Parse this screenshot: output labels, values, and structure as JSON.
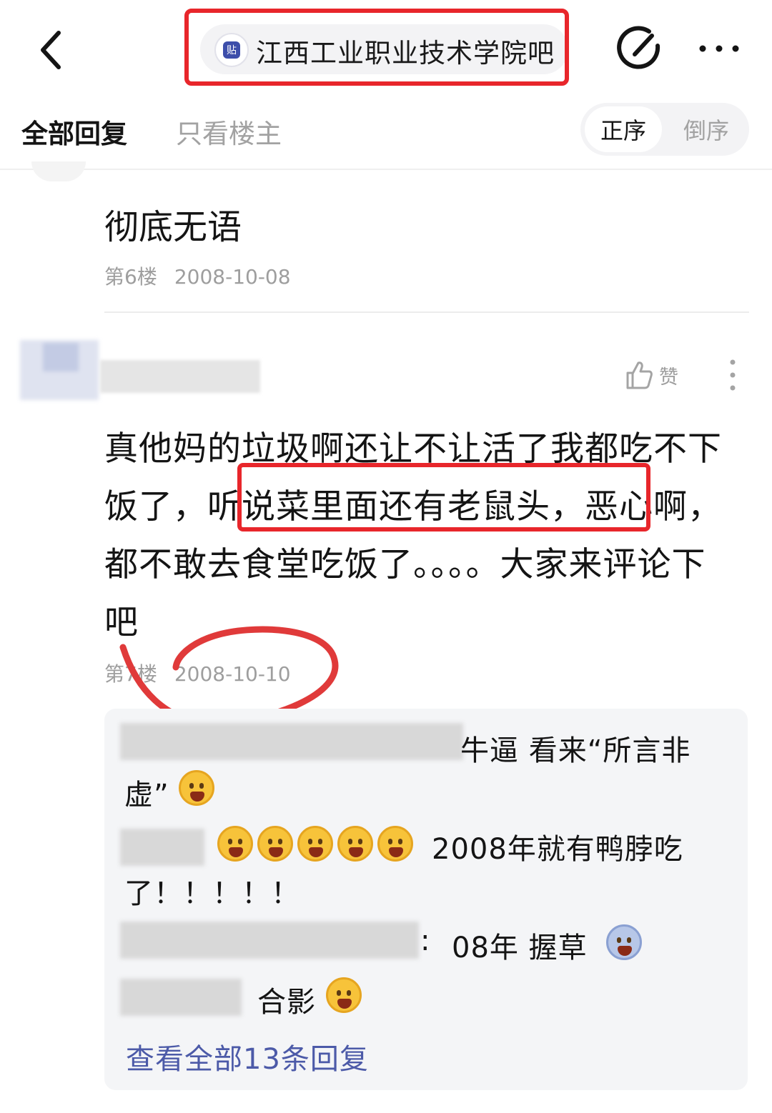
{
  "header": {
    "forum_name": "江西工业职业技术学院吧",
    "logo_glyph": "贴",
    "highlight_color": "#e8262b"
  },
  "tabs": {
    "all_replies": "全部回复",
    "op_only": "只看楼主",
    "sort_asc": "正序",
    "sort_desc": "倒序"
  },
  "floor6": {
    "text": "彻底无语",
    "floor_label": "第6楼",
    "date": "2008-10-08"
  },
  "floor7": {
    "like_label": "赞",
    "body_before": "真他妈的垃圾啊还让不让活了我都吃不下饭了，",
    "body_highlight": "听说菜里面还有老鼠头，",
    "body_after": "恶心啊，都不敢去食堂吃饭了。。。。大家来评论下吧",
    "floor_label": "第7楼",
    "date": "2008-10-10"
  },
  "replies": {
    "r1_line1": "牛逼 看来“所言非",
    "r1_line2": "虚”",
    "r2_line1": "2008年就有鸭脖吃",
    "r2_line2": "了！！！！！",
    "r3_sep": ":",
    "r3_text": "08年 握草",
    "r4_text": "合影",
    "view_all": "查看全部13条回复"
  },
  "icons": {
    "back": "back-chevron-icon",
    "edit": "edit-pen-icon",
    "more": "more-dots-icon",
    "like": "thumbs-up-icon",
    "kebab": "vertical-dots-icon",
    "emoji_angry": "angry-face-emoji",
    "emoji_fear": "screaming-face-emoji",
    "emoji_laugh": "laughing-face-emoji"
  }
}
